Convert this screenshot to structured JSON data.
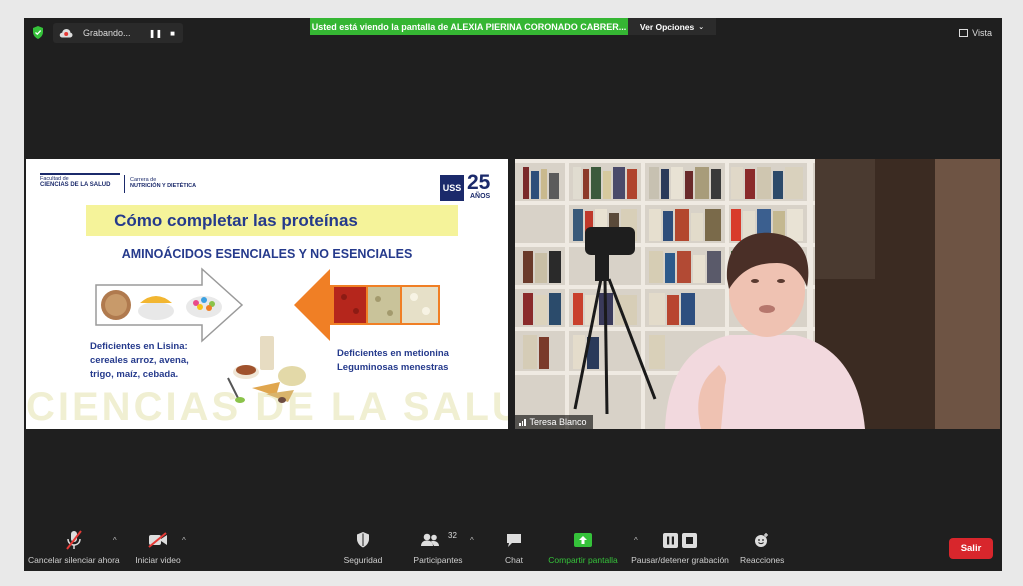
{
  "top_bar": {
    "recording_label": "Grabando...",
    "share_banner": "Usted está viendo la pantalla de ALEXIA PIERINA CORONADO CABRER...",
    "view_options": "Ver Opciones",
    "view_label": "Vista"
  },
  "slide": {
    "faculty_small": "Facultad de",
    "faculty": "CIENCIAS DE LA SALUD",
    "career_small": "Carrera de",
    "career": "NUTRICIÓN Y DIETÉTICA",
    "logo_text": "USS",
    "logo_number": "25",
    "logo_years": "AÑOS",
    "title": "Cómo completar las proteínas",
    "subtitle": "AMINOÁCIDOS ESENCIALES Y NO ESENCIALES",
    "left_text": [
      "Deficientes en Lisina:",
      "cereales arroz, avena,",
      "trigo, maíz, cebada."
    ],
    "right_text": [
      "Deficientes en metionina",
      "Leguminosas menestras"
    ],
    "watermark": "CIENCIAS DE LA SALUD"
  },
  "camera": {
    "participant_name": "Teresa Blanco"
  },
  "toolbar": {
    "mute_label": "Cancelar silenciar ahora",
    "video_label": "Iniciar video",
    "security_label": "Seguridad",
    "participants_label": "Participantes",
    "participants_count": "32",
    "chat_label": "Chat",
    "share_label": "Compartir pantalla",
    "record_label": "Pausar/detener grabación",
    "reactions_label": "Reacciones",
    "leave_label": "Salir"
  },
  "colors": {
    "window_bg": "#1f1f1f",
    "share_green": "#35b633",
    "leave_red": "#d8262c",
    "slide_title": "#253a8c",
    "title_highlight": "#f5f39a",
    "arrow_orange": "#f07f25"
  }
}
